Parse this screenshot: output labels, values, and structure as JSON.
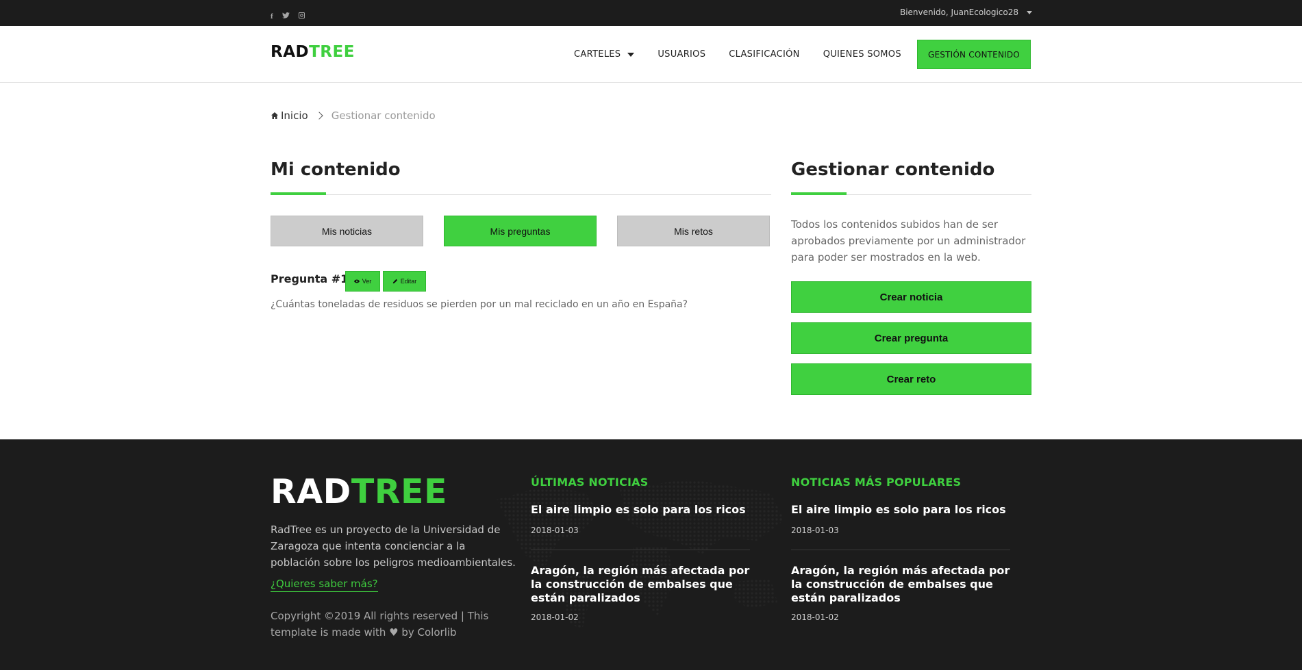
{
  "colors": {
    "accent": "#40d040",
    "dark": "#1c1c1c",
    "tab_grey": "#cccccc"
  },
  "topbar": {
    "social_icons": [
      "facebook-icon",
      "twitter-icon",
      "instagram-icon"
    ],
    "social_glyphs": [
      "f",
      "🐦",
      "◙"
    ],
    "welcome": "Bienvenido, JuanEcologico28"
  },
  "header": {
    "logo_part1": "RAD",
    "logo_part2": "TREE",
    "nav": [
      {
        "label": "CARTELES"
      },
      {
        "label": "USUARIOS"
      },
      {
        "label": "CLASIFICACIÓN"
      },
      {
        "label": "QUIENES SOMOS"
      }
    ],
    "cta": "GESTIÓN CONTENIDO"
  },
  "breadcrumb": {
    "home": "Inicio",
    "current": "Gestionar contenido"
  },
  "main": {
    "title": "Mi contenido",
    "tabs": [
      {
        "label": "Mis noticias",
        "active": false
      },
      {
        "label": "Mis preguntas",
        "active": true
      },
      {
        "label": "Mis retos",
        "active": false
      }
    ],
    "question": {
      "title": "Pregunta #1",
      "view_label": "Ver",
      "edit_label": "Editar",
      "text": "¿Cuántas toneladas de residuos se pierden por un mal reciclado en un año en España?"
    }
  },
  "side": {
    "title": "Gestionar contenido",
    "description": "Todos los contenidos subidos han de ser aprobados previamente por un administrador para poder ser mostrados en la web.",
    "buttons": [
      "Crear noticia",
      "Crear pregunta",
      "Crear reto"
    ]
  },
  "footer": {
    "logo_part1": "RAD",
    "logo_part2": "TREE",
    "description": "RadTree es un proyecto de la Universidad de Zaragoza que intenta concienciar a la población sobre los peligros medioambientales.",
    "more_link": "¿Quieres saber más?",
    "copyright": "Copyright ©2019 All rights reserved | This template is made with ♥ by Colorlib",
    "latest": {
      "title": "ÚLTIMAS NOTICIAS",
      "items": [
        {
          "title": "El aire limpio es solo para los ricos",
          "date": "2018-01-03"
        },
        {
          "title": "Aragón, la región más afectada por la construcción de embalses que están paralizados",
          "date": "2018-01-02"
        }
      ]
    },
    "popular": {
      "title": "NOTICIAS MÁS POPULARES",
      "items": [
        {
          "title": "El aire limpio es solo para los ricos",
          "date": "2018-01-03"
        },
        {
          "title": "Aragón, la región más afectada por la construcción de embalses que están paralizados",
          "date": "2018-01-02"
        }
      ]
    }
  }
}
